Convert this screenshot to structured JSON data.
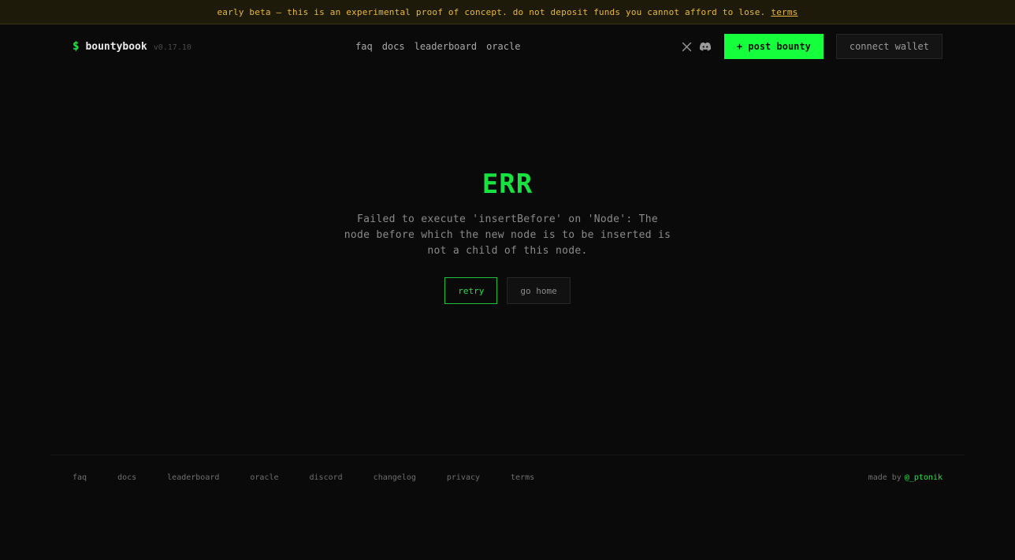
{
  "banner": {
    "text": "early beta — this is an experimental proof of concept. do not deposit funds you cannot afford to lose.",
    "link": "terms",
    "color": "#e6b93a"
  },
  "header": {
    "brand_symbol": "$",
    "brand_name": "bountybook",
    "version": "v0.17.10",
    "nav": [
      "faq",
      "docs",
      "leaderboard",
      "oracle"
    ],
    "icons": [
      "x-icon",
      "discord-icon"
    ],
    "post_label": "+ post bounty",
    "wallet_label": "connect wallet",
    "accent": "#16ff3c"
  },
  "error": {
    "title": "ERR",
    "message": "Failed to execute 'insertBefore' on 'Node': The node before which the new node is to be inserted is not a child of this node.",
    "retry_label": "retry",
    "home_label": "go home"
  },
  "footer": {
    "links": [
      "faq",
      "docs",
      "leaderboard",
      "oracle",
      "discord",
      "changelog",
      "privacy",
      "terms"
    ],
    "made_by_text": "made by",
    "made_by_handle": "@_ptonik"
  }
}
